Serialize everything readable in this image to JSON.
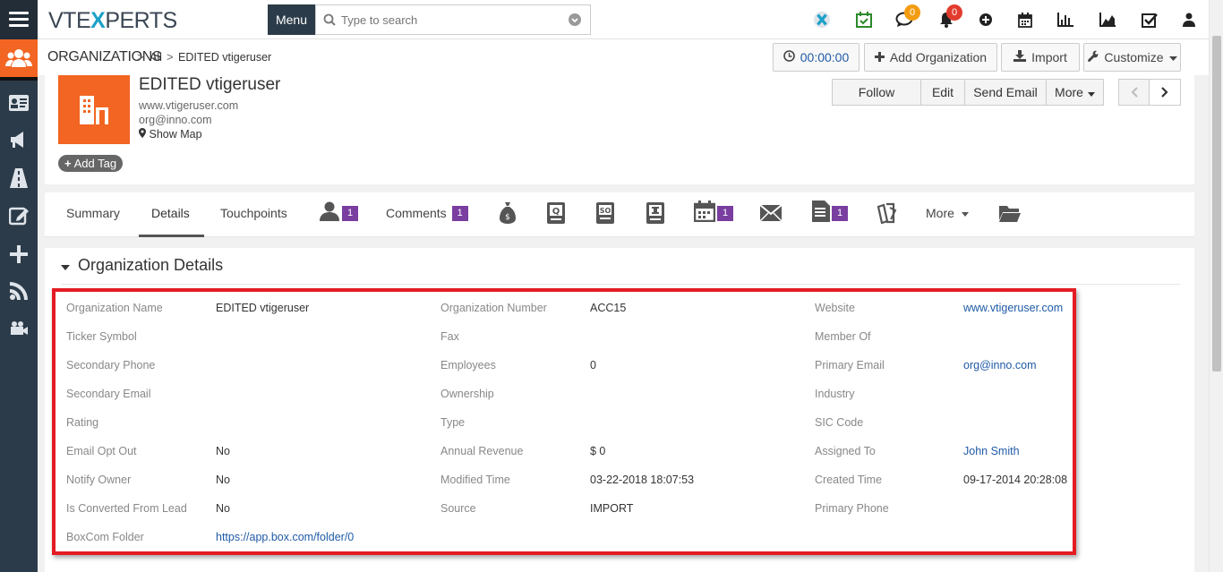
{
  "topbar": {
    "logo_pre": "VTE",
    "logo_x": "X",
    "logo_post": "PERTS",
    "menu_label": "Menu",
    "search_placeholder": "Type to search",
    "chat_badge": "0",
    "notif_badge": "0"
  },
  "breadcrumb": {
    "module": "ORGANIZATIONS",
    "filter": "All",
    "record": "EDITED vtigeruser",
    "timer": "00:00:00",
    "add_label": "Add Organization",
    "import_label": "Import",
    "customize_label": "Customize"
  },
  "record": {
    "title": "EDITED vtigeruser",
    "website": "www.vtigeruser.com",
    "email": "org@inno.com",
    "show_map": "Show Map",
    "add_tag": "Add Tag",
    "actions": {
      "follow": "Follow",
      "edit": "Edit",
      "send_email": "Send Email",
      "more": "More"
    }
  },
  "tabs": {
    "summary": "Summary",
    "details": "Details",
    "touchpoints": "Touchpoints",
    "contacts_count": "1",
    "comments": "Comments",
    "comments_count": "1",
    "events_count": "1",
    "docs_count": "1",
    "more": "More"
  },
  "details": {
    "section_title": "Organization Details",
    "col1": [
      {
        "label": "Organization Name",
        "value": "EDITED vtigeruser"
      },
      {
        "label": "Ticker Symbol",
        "value": ""
      },
      {
        "label": "Secondary Phone",
        "value": ""
      },
      {
        "label": "Secondary Email",
        "value": ""
      },
      {
        "label": "Rating",
        "value": ""
      },
      {
        "label": "Email Opt Out",
        "value": "No"
      },
      {
        "label": "Notify Owner",
        "value": "No"
      },
      {
        "label": "Is Converted From Lead",
        "value": "No"
      },
      {
        "label": "BoxCom Folder",
        "value": "https://app.box.com/folder/0"
      }
    ],
    "col2": [
      {
        "label": "Organization Number",
        "value": "ACC15"
      },
      {
        "label": "Fax",
        "value": ""
      },
      {
        "label": "Employees",
        "value": "0"
      },
      {
        "label": "Ownership",
        "value": ""
      },
      {
        "label": "Type",
        "value": ""
      },
      {
        "label": "Annual Revenue",
        "value": "$ 0"
      },
      {
        "label": "Modified Time",
        "value": "03-22-2018 18:07:53"
      },
      {
        "label": "Source",
        "value": "IMPORT"
      }
    ],
    "col3": [
      {
        "label": "Website",
        "value": "www.vtigeruser.com"
      },
      {
        "label": "Member Of",
        "value": ""
      },
      {
        "label": "Primary Email",
        "value": "org@inno.com"
      },
      {
        "label": "Industry",
        "value": ""
      },
      {
        "label": "SIC Code",
        "value": ""
      },
      {
        "label": "Assigned To",
        "value": "John Smith"
      },
      {
        "label": "Created Time",
        "value": "09-17-2014 20:28:08"
      },
      {
        "label": "Primary Phone",
        "value": ""
      }
    ]
  },
  "colors": {
    "accent": "#f26522",
    "rail": "#2c3b49",
    "highlight": "#e41b23",
    "link": "#1f5aa6"
  }
}
